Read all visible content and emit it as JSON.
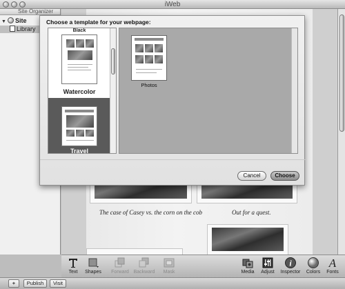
{
  "window": {
    "title": "iWeb"
  },
  "sidebar": {
    "header": "Site Organizer",
    "site_label": "Site",
    "library_label": "Library"
  },
  "canvas": {
    "captions": [
      "The case of Casey vs. the corn on the cob",
      "Out for a quest."
    ]
  },
  "sheet": {
    "title": "Choose a template for your webpage:",
    "cut_label": "Black",
    "templates": [
      {
        "label": "Watercolor",
        "selected": false
      },
      {
        "label": "Travel",
        "selected": true
      }
    ],
    "page_options": [
      {
        "label": "Photos"
      }
    ],
    "cancel_label": "Cancel",
    "choose_label": "Choose"
  },
  "toolbar": {
    "items": [
      {
        "label": "Text",
        "icon": "text-icon",
        "enabled": true
      },
      {
        "label": "Shapes",
        "icon": "shapes-icon",
        "enabled": true
      },
      {
        "label": "Forward",
        "icon": "forward-icon",
        "enabled": false
      },
      {
        "label": "Backward",
        "icon": "backward-icon",
        "enabled": false
      },
      {
        "label": "Mask",
        "icon": "mask-icon",
        "enabled": false
      },
      {
        "label": "Media",
        "icon": "media-icon",
        "enabled": true
      },
      {
        "label": "Adjust",
        "icon": "adjust-icon",
        "enabled": true
      },
      {
        "label": "Inspector",
        "icon": "inspector-icon",
        "enabled": true
      },
      {
        "label": "Colors",
        "icon": "colors-icon",
        "enabled": true
      },
      {
        "label": "Fonts",
        "icon": "fonts-icon",
        "enabled": true
      }
    ]
  },
  "bottombar": {
    "add_label": "+",
    "publish_label": "Publish",
    "visit_label": "Visit"
  }
}
